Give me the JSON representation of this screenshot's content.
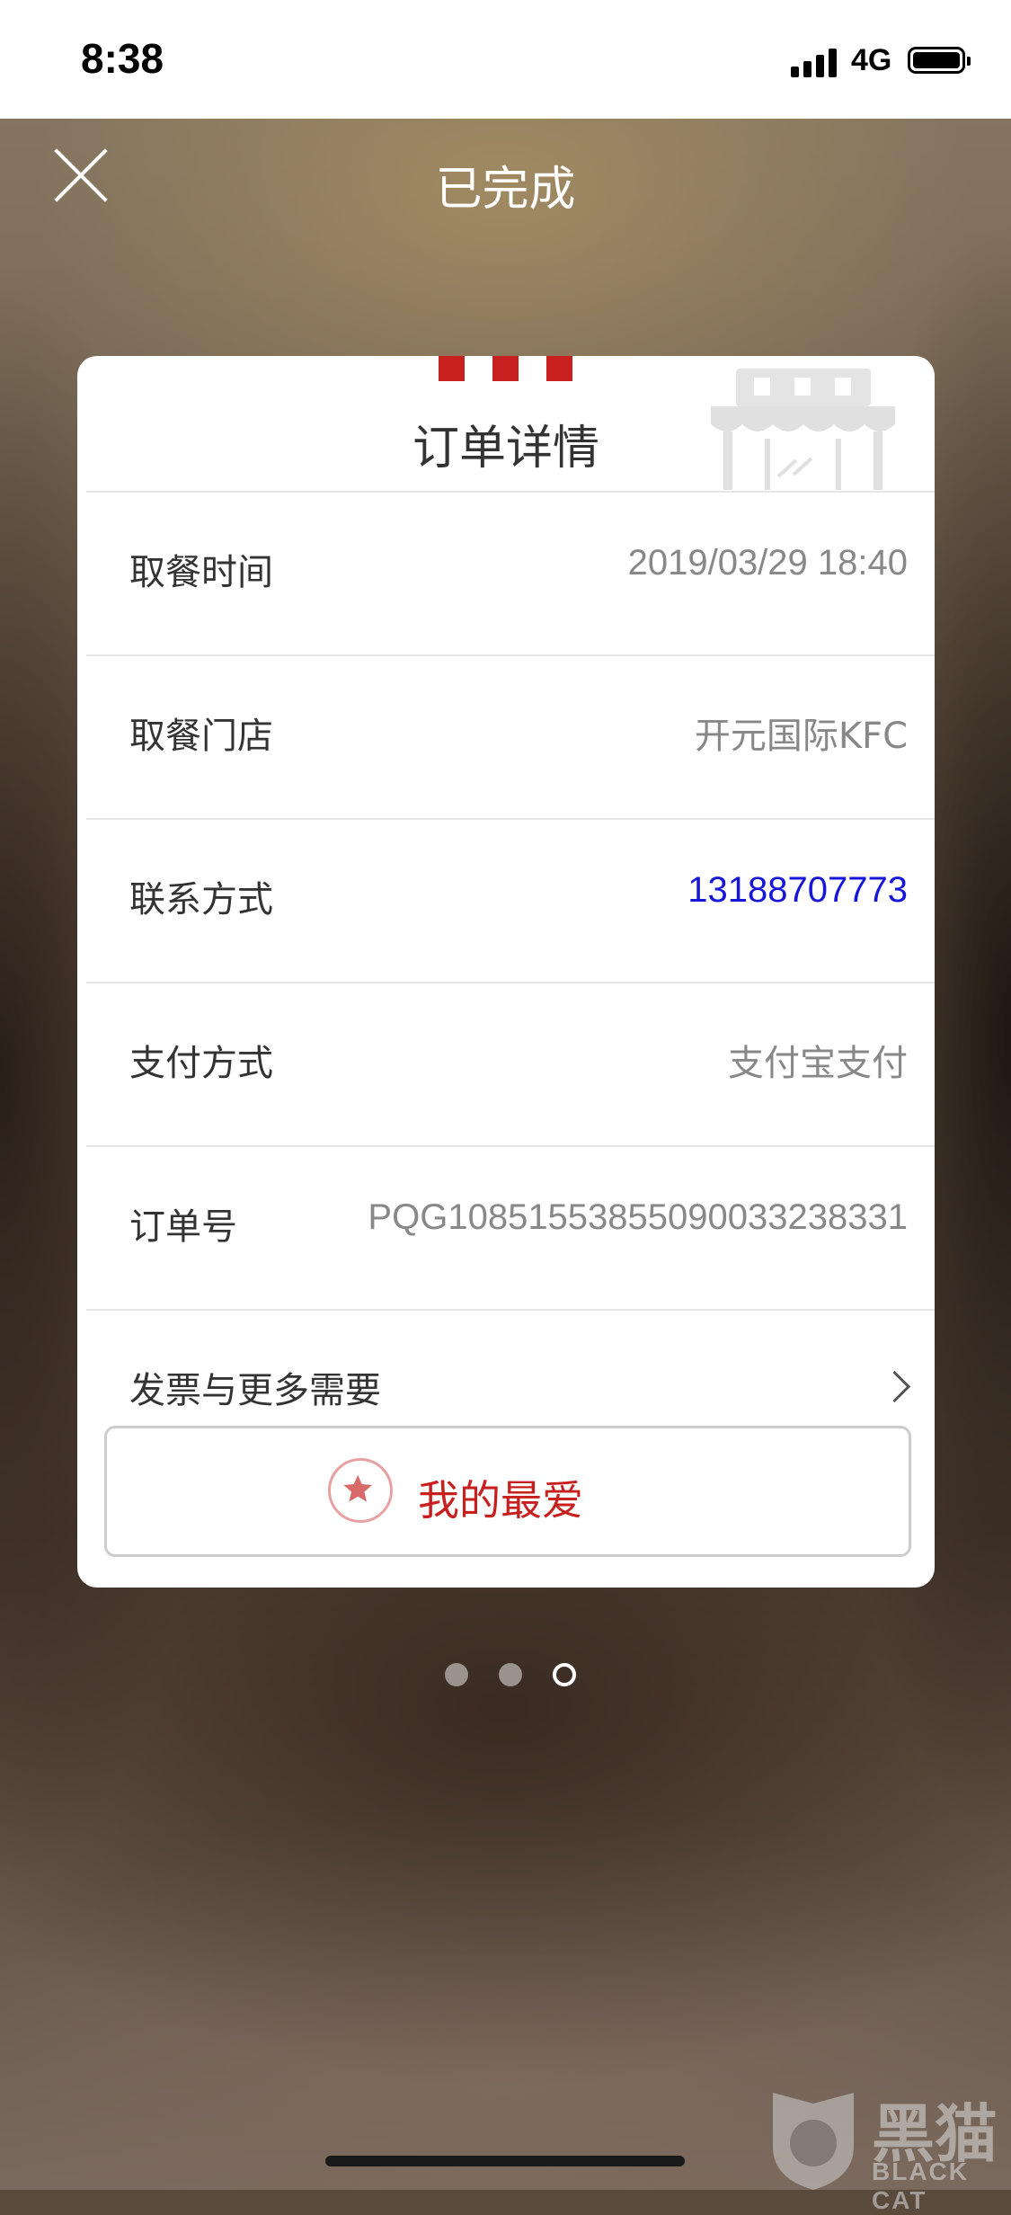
{
  "status_bar": {
    "time": "8:38",
    "network": "4G"
  },
  "nav": {
    "title": "已完成"
  },
  "card": {
    "title": "订单详情",
    "rows": [
      {
        "label": "取餐时间",
        "value": "2019/03/29 18:40"
      },
      {
        "label": "取餐门店",
        "value": "开元国际KFC"
      },
      {
        "label": "联系方式",
        "value": "13188707773"
      },
      {
        "label": "支付方式",
        "value": "支付宝支付"
      },
      {
        "label": "订单号",
        "value": "PQG10851553855090033238331"
      },
      {
        "label": "发票与更多需要"
      }
    ],
    "favorite_label": "我的最爱"
  },
  "pager": {
    "count": 3,
    "active_index": 2
  },
  "watermark": {
    "cn": "黑猫",
    "en": "BLACK CAT"
  },
  "colors": {
    "accent_red": "#c8201f",
    "phone_blue": "#1616d8"
  }
}
